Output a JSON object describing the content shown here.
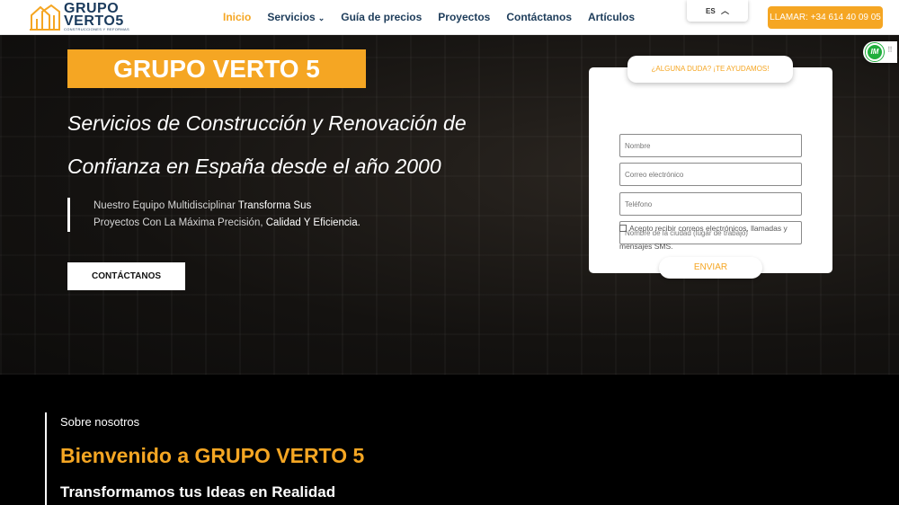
{
  "header": {
    "logo_line1": "GRUPO",
    "logo_line2": "VERTO5",
    "logo_tagline": "CONSTRUCCIONES Y REFORMAS",
    "nav": [
      {
        "label": "Inicio",
        "active": true
      },
      {
        "label": "Servicios",
        "has_dropdown": true
      },
      {
        "label": "Guía de precios"
      },
      {
        "label": "Proyectos"
      },
      {
        "label": "Contáctanos"
      },
      {
        "label": "Artículos"
      }
    ],
    "language": "ES",
    "call_button": "LLAMAR: +34 614 40 09 05"
  },
  "hero": {
    "badge_title": "GRUPO VERTO 5",
    "heading": "Servicios de Construcción y Renovación de Confianza en España desde el año 2000",
    "quote_part1": "Nuestro Equipo Multidisciplinar ",
    "quote_bold1": "Transforma Sus",
    "quote_part2": "Proyectos Con La Máxima Precisión, ",
    "quote_bold2": "Calidad Y Eficiencia.",
    "cta_button": "CONTÁCTANOS"
  },
  "form": {
    "tab_label": "¿ALGUNA DUDA? ¡TE AYUDAMOS!",
    "fields": [
      {
        "placeholder": "Nombre"
      },
      {
        "placeholder": "Correo electrónico"
      },
      {
        "placeholder": "Teléfono"
      },
      {
        "placeholder": "Nombre de la ciudad (lugar de trabajo)"
      }
    ],
    "consent": "Acepto recibir correos electrónicos, llamadas y mensajes SMS.",
    "submit": "ENVIAR"
  },
  "widget": {
    "initials": "IM"
  },
  "about": {
    "kicker": "Sobre nosotros",
    "title": "Bienvenido a GRUPO VERTO 5",
    "subtitle": "Transformamos tus Ideas en Realidad"
  },
  "colors": {
    "accent": "#f5a623",
    "navy": "#1d3c5a",
    "widget_green": "#1fae3c"
  }
}
